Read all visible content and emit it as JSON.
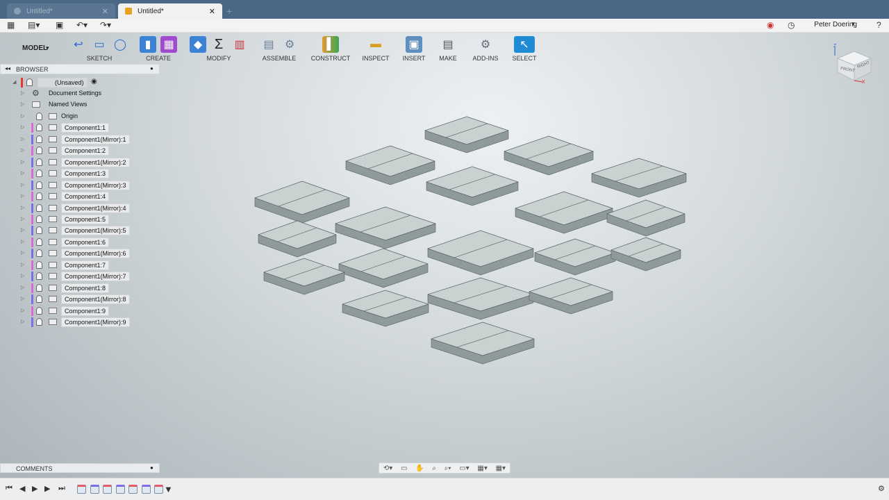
{
  "tabs": [
    {
      "label": "Untitled*",
      "active": false
    },
    {
      "label": "Untitled*",
      "active": true
    }
  ],
  "quick_access": {
    "user": "Peter Doering"
  },
  "toolbar": {
    "mode": "MODEL",
    "groups": [
      "SKETCH",
      "CREATE",
      "MODIFY",
      "ASSEMBLE",
      "CONSTRUCT",
      "INSPECT",
      "INSERT",
      "MAKE",
      "ADD-INS",
      "SELECT"
    ]
  },
  "browser": {
    "title": "BROWSER",
    "root": "(Unsaved)",
    "items": [
      "Document Settings",
      "Named Views",
      "Origin",
      "Component1:1",
      "Component1(Mirror):1",
      "Component1:2",
      "Component1(Mirror):2",
      "Component1:3",
      "Component1(Mirror):3",
      "Component1:4",
      "Component1(Mirror):4",
      "Component1:5",
      "Component1(Mirror):5",
      "Component1:6",
      "Component1(Mirror):6",
      "Component1:7",
      "Component1(Mirror):7",
      "Component1:8",
      "Component1(Mirror):8",
      "Component1:9",
      "Component1(Mirror):9"
    ]
  },
  "viewcube": {
    "front": "FRONT",
    "right": "RIGHT",
    "axis_x": "X",
    "axis_z": "Z"
  },
  "comments": {
    "title": "COMMENTS"
  },
  "colors": {
    "title_bar": "#4a6785",
    "tile_top": "#c9d1d1",
    "tile_side": "#8f9a9a",
    "component_stripe": "#d86ad8",
    "mirror_stripe": "#7b6ee8"
  }
}
